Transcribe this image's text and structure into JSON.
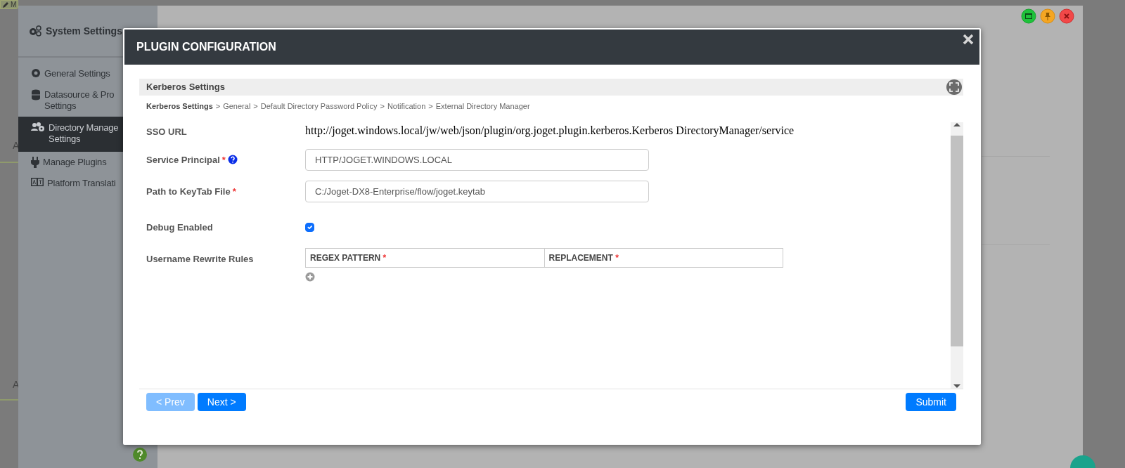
{
  "background": {
    "tag": {
      "label": "M"
    },
    "letters": [
      "A",
      "A"
    ]
  },
  "sidebar": {
    "title": "System Settings",
    "items": [
      {
        "lines": [
          "General Settings"
        ],
        "selected": false
      },
      {
        "lines": [
          "Datasource & Pro",
          "Settings"
        ],
        "selected": false
      },
      {
        "lines": [
          "Directory Manage",
          "Settings"
        ],
        "selected": true
      },
      {
        "lines": [
          "Manage Plugins"
        ],
        "selected": false
      },
      {
        "lines": [
          "Platform Translati"
        ],
        "selected": false
      }
    ]
  },
  "modal": {
    "title": "PLUGIN CONFIGURATION",
    "section_title": "Kerberos Settings",
    "breadcrumb": [
      {
        "label": "Kerberos Settings",
        "current": true
      },
      {
        "label": "General",
        "current": false
      },
      {
        "label": "Default Directory Password Policy",
        "current": false
      },
      {
        "label": "Notification",
        "current": false
      },
      {
        "label": "External Directory Manager",
        "current": false
      }
    ],
    "breadcrumb_separator": ">",
    "fields": [
      {
        "kind": "text",
        "label": "SSO URL",
        "value": "http://joget.windows.local/jw/web/json/plugin/org.joget.plugin.kerberos.Kerberos DirectoryManager/service"
      },
      {
        "kind": "input",
        "label": "Service Principal",
        "required_mark": "*",
        "help": true,
        "value": "HTTP/JOGET.WINDOWS.LOCAL"
      },
      {
        "kind": "input",
        "label": "Path to KeyTab File",
        "required_mark": "*",
        "value": "C:/Joget-DX8-Enterprise/flow/joget.keytab"
      },
      {
        "kind": "checkbox",
        "label": "Debug Enabled",
        "checked": true
      },
      {
        "kind": "grid",
        "label": "Username Rewrite Rules",
        "columns": [
          {
            "label": "REGEX PATTERN",
            "required_mark": "*"
          },
          {
            "label": "REPLACEMENT",
            "required_mark": "*"
          }
        ]
      }
    ],
    "nav_buttons": [
      {
        "label": "< Prev",
        "disabled": true
      },
      {
        "label": "Next >",
        "disabled": false
      }
    ],
    "submit": {
      "label": "Submit"
    }
  }
}
